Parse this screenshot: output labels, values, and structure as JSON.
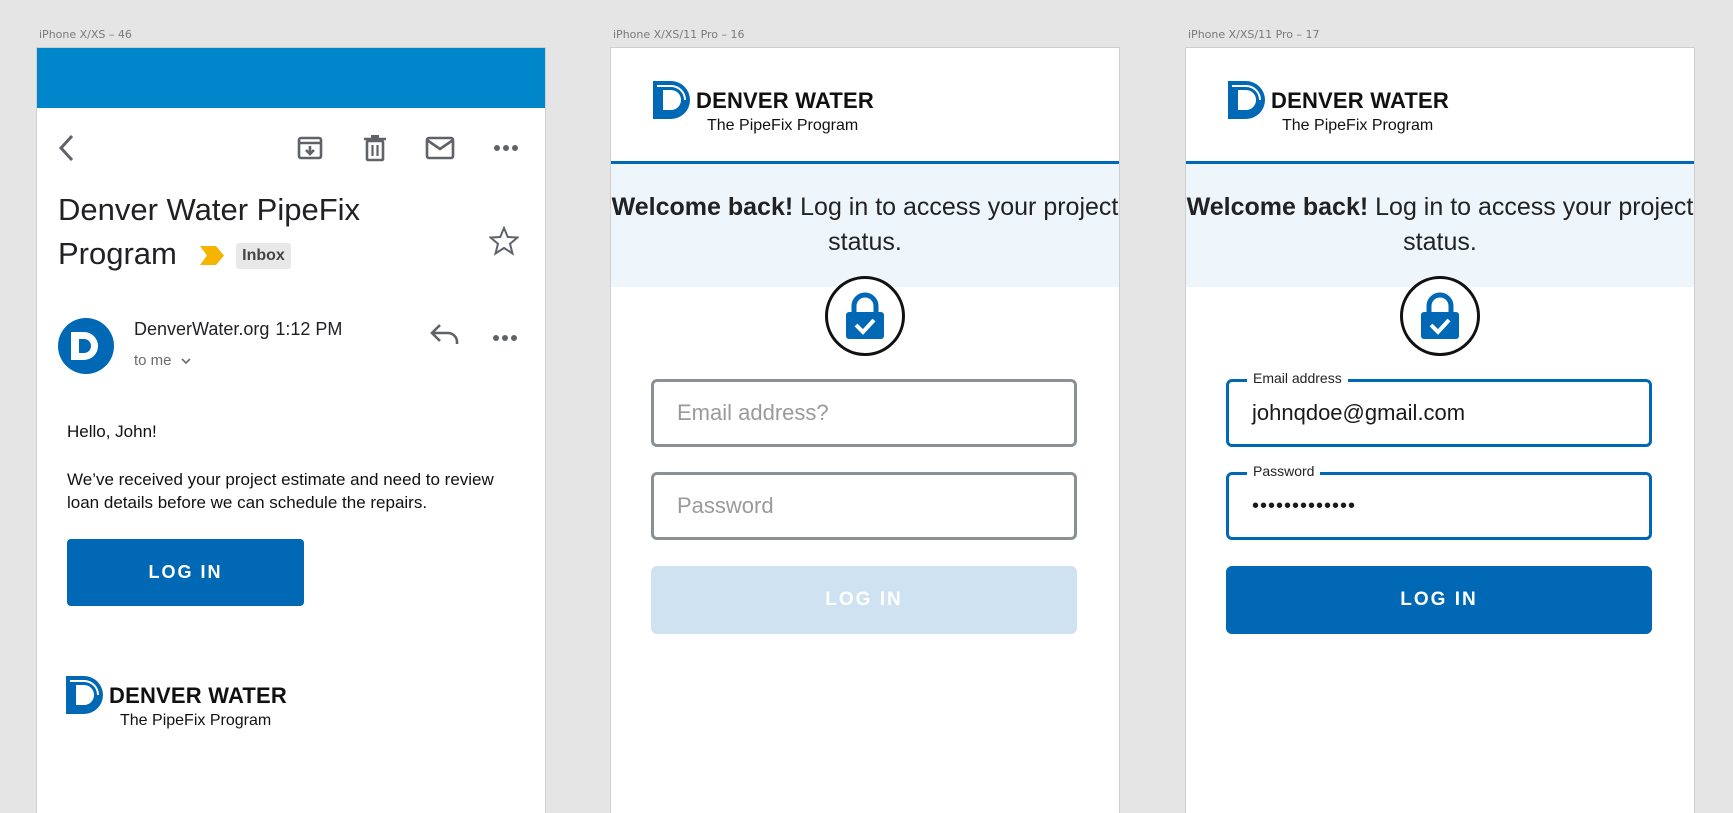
{
  "artboards": [
    "iPhone X/XS – 46",
    "iPhone X/XS/11 Pro – 16",
    "iPhone X/XS/11 Pro – 17"
  ],
  "colors": {
    "brand_blue": "#0068b4",
    "email_bar": "#0087cb",
    "welcome_bg": "#eef6fc",
    "importance": "#f5b400"
  },
  "email": {
    "subject": "Denver Water PipeFix Program",
    "label": "Inbox",
    "sender": "DenverWater.org",
    "time": "1:12 PM",
    "to": "to me",
    "greeting": "Hello, John!",
    "body": "We’ve received your project estimate and need to review loan details before we can schedule the repairs.",
    "button": "LOG IN",
    "icons": [
      "back-icon",
      "archive-icon",
      "delete-icon",
      "mail-icon",
      "more-icon",
      "star-icon",
      "reply-icon"
    ]
  },
  "logo": {
    "name": "DENVER WATER",
    "program": "The PipeFix Program"
  },
  "login_empty": {
    "welcome_bold": "Welcome back!",
    "welcome_rest": " Log in to access your project status.",
    "email_placeholder": "Email address?",
    "password_placeholder": "Password",
    "button": "LOG IN"
  },
  "login_filled": {
    "welcome_bold": "Welcome back!",
    "welcome_rest": " Log in to access your project status.",
    "email_label": "Email address",
    "email_value": "johnqdoe@gmail.com",
    "password_label": "Password",
    "password_value": "•••••••••••••",
    "button": "LOG IN"
  }
}
